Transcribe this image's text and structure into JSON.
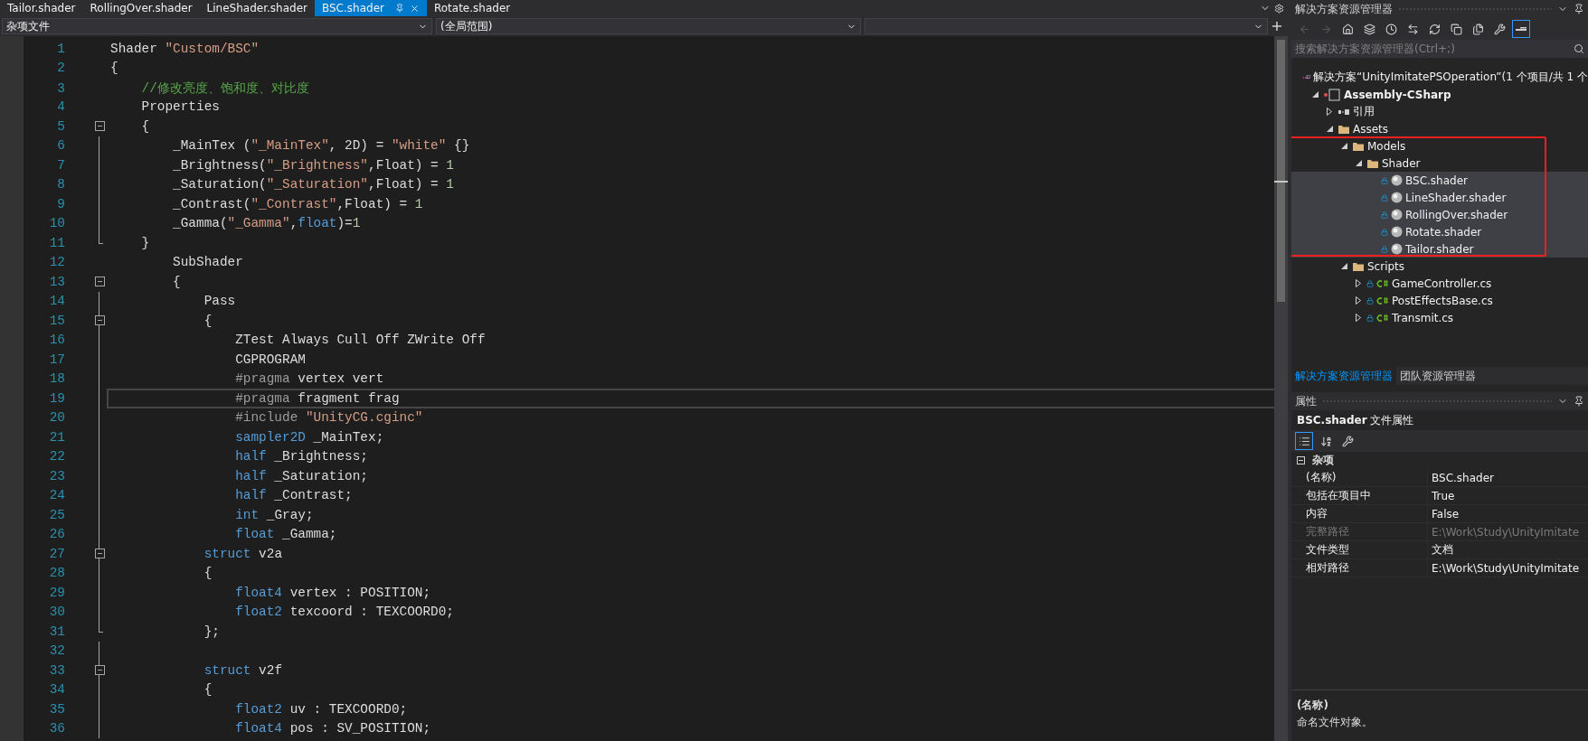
{
  "doc_tabs": [
    {
      "label": "Tailor.shader",
      "selected": false
    },
    {
      "label": "RollingOver.shader",
      "selected": false
    },
    {
      "label": "LineShader.shader",
      "selected": false
    },
    {
      "label": "BSC.shader",
      "selected": true
    },
    {
      "label": "Rotate.shader",
      "selected": false
    }
  ],
  "nav_bar": {
    "project": "杂项文件",
    "scope": "(全局范围)"
  },
  "code_lines": [
    {
      "n": "1",
      "kind": "code",
      "tokens": [
        {
          "kind": "plain",
          "text": "Shader "
        },
        {
          "kind": "string",
          "text": "\"Custom/BSC\""
        }
      ]
    },
    {
      "n": "2",
      "kind": "code",
      "tokens": [
        {
          "kind": "plain",
          "text": "{"
        }
      ]
    },
    {
      "n": "3",
      "kind": "code",
      "tokens": [
        {
          "kind": "comment",
          "text": "    //修改亮度、饱和度、对比度"
        }
      ]
    },
    {
      "n": "4",
      "kind": "code",
      "tokens": [
        {
          "kind": "plain",
          "text": "    Properties"
        }
      ]
    },
    {
      "n": "5",
      "kind": "fold-start",
      "expanded": true,
      "tokens": [
        {
          "kind": "plain",
          "text": "    {"
        }
      ]
    },
    {
      "n": "6",
      "kind": "code",
      "tokens": [
        {
          "kind": "plain",
          "text": "        _MainTex ("
        },
        {
          "kind": "string",
          "text": "\"_MainTex\""
        },
        {
          "kind": "plain",
          "text": ", 2D) = "
        },
        {
          "kind": "string",
          "text": "\"white\""
        },
        {
          "kind": "plain",
          "text": " {}"
        }
      ]
    },
    {
      "n": "7",
      "kind": "code",
      "tokens": [
        {
          "kind": "plain",
          "text": "        _Brightness("
        },
        {
          "kind": "string",
          "text": "\"_Brightness\""
        },
        {
          "kind": "plain",
          "text": ",Float) = "
        },
        {
          "kind": "number",
          "text": "1"
        }
      ]
    },
    {
      "n": "8",
      "kind": "code",
      "tokens": [
        {
          "kind": "plain",
          "text": "        _Saturation("
        },
        {
          "kind": "string",
          "text": "\"_Saturation\""
        },
        {
          "kind": "plain",
          "text": ",Float) = "
        },
        {
          "kind": "number",
          "text": "1"
        }
      ]
    },
    {
      "n": "9",
      "kind": "code",
      "tokens": [
        {
          "kind": "plain",
          "text": "        _Contrast("
        },
        {
          "kind": "string",
          "text": "\"_Contrast\""
        },
        {
          "kind": "plain",
          "text": ",Float) = "
        },
        {
          "kind": "number",
          "text": "1"
        }
      ]
    },
    {
      "n": "10",
      "kind": "code",
      "tokens": [
        {
          "kind": "plain",
          "text": "        _Gamma("
        },
        {
          "kind": "string",
          "text": "\"_Gamma\""
        },
        {
          "kind": "plain",
          "text": ","
        },
        {
          "kind": "keyword",
          "text": "float"
        },
        {
          "kind": "plain",
          "text": ")="
        },
        {
          "kind": "number",
          "text": "1"
        }
      ]
    },
    {
      "n": "11",
      "kind": "fold-end",
      "tokens": [
        {
          "kind": "plain",
          "text": "    }"
        }
      ]
    },
    {
      "n": "12",
      "kind": "code",
      "tokens": [
        {
          "kind": "plain",
          "text": "        SubShader"
        }
      ]
    },
    {
      "n": "13",
      "kind": "fold-start",
      "expanded": true,
      "tokens": [
        {
          "kind": "plain",
          "text": "        {"
        }
      ]
    },
    {
      "n": "14",
      "kind": "code",
      "tokens": [
        {
          "kind": "plain",
          "text": "            Pass"
        }
      ]
    },
    {
      "n": "15",
      "kind": "fold-start",
      "expanded": true,
      "tokens": [
        {
          "kind": "plain",
          "text": "            {"
        }
      ]
    },
    {
      "n": "16",
      "kind": "code",
      "tokens": [
        {
          "kind": "plain",
          "text": "                ZTest Always Cull Off ZWrite Off"
        }
      ]
    },
    {
      "n": "17",
      "kind": "code",
      "tokens": [
        {
          "kind": "plain",
          "text": "                CGPROGRAM"
        }
      ]
    },
    {
      "n": "18",
      "kind": "code",
      "tokens": [
        {
          "kind": "preproc",
          "text": "                #pragma"
        },
        {
          "kind": "plain",
          "text": " vertex vert"
        }
      ]
    },
    {
      "n": "19",
      "kind": "code",
      "current": true,
      "tokens": [
        {
          "kind": "preproc",
          "text": "                #pragma"
        },
        {
          "kind": "plain",
          "text": " fragment frag"
        }
      ]
    },
    {
      "n": "20",
      "kind": "code",
      "tokens": [
        {
          "kind": "preproc",
          "text": "                #include "
        },
        {
          "kind": "string",
          "text": "\"UnityCG.cginc\""
        }
      ]
    },
    {
      "n": "21",
      "kind": "code",
      "tokens": [
        {
          "kind": "keyword",
          "text": "                sampler2D"
        },
        {
          "kind": "plain",
          "text": " _MainTex;"
        }
      ]
    },
    {
      "n": "22",
      "kind": "code",
      "tokens": [
        {
          "kind": "keyword",
          "text": "                half"
        },
        {
          "kind": "plain",
          "text": " _Brightness;"
        }
      ]
    },
    {
      "n": "23",
      "kind": "code",
      "tokens": [
        {
          "kind": "keyword",
          "text": "                half"
        },
        {
          "kind": "plain",
          "text": " _Saturation;"
        }
      ]
    },
    {
      "n": "24",
      "kind": "code",
      "tokens": [
        {
          "kind": "keyword",
          "text": "                half"
        },
        {
          "kind": "plain",
          "text": " _Contrast;"
        }
      ]
    },
    {
      "n": "25",
      "kind": "code",
      "tokens": [
        {
          "kind": "keyword",
          "text": "                int"
        },
        {
          "kind": "plain",
          "text": " _Gray;"
        }
      ]
    },
    {
      "n": "26",
      "kind": "code",
      "tokens": [
        {
          "kind": "keyword",
          "text": "                float"
        },
        {
          "kind": "plain",
          "text": " _Gamma;"
        }
      ]
    },
    {
      "n": "27",
      "kind": "fold-start",
      "expanded": true,
      "tokens": [
        {
          "kind": "keyword",
          "text": "            struct"
        },
        {
          "kind": "plain",
          "text": " v2a"
        }
      ]
    },
    {
      "n": "28",
      "kind": "code",
      "tokens": [
        {
          "kind": "plain",
          "text": "            {"
        }
      ]
    },
    {
      "n": "29",
      "kind": "code",
      "tokens": [
        {
          "kind": "keyword",
          "text": "                float4"
        },
        {
          "kind": "plain",
          "text": " vertex : POSITION;"
        }
      ]
    },
    {
      "n": "30",
      "kind": "code",
      "tokens": [
        {
          "kind": "keyword",
          "text": "                float2"
        },
        {
          "kind": "plain",
          "text": " texcoord : TEXCOORD0;"
        }
      ]
    },
    {
      "n": "31",
      "kind": "fold-end",
      "tokens": [
        {
          "kind": "plain",
          "text": "            };"
        }
      ]
    },
    {
      "n": "32",
      "kind": "code"
    },
    {
      "n": "33",
      "kind": "fold-start",
      "expanded": true,
      "tokens": [
        {
          "kind": "keyword",
          "text": "            struct"
        },
        {
          "kind": "plain",
          "text": " v2f"
        }
      ]
    },
    {
      "n": "34",
      "kind": "code",
      "tokens": [
        {
          "kind": "plain",
          "text": "            {"
        }
      ]
    },
    {
      "n": "35",
      "kind": "code",
      "tokens": [
        {
          "kind": "keyword",
          "text": "                float2"
        },
        {
          "kind": "plain",
          "text": " uv : TEXCOORD0;"
        }
      ]
    },
    {
      "n": "36",
      "kind": "code",
      "tokens": [
        {
          "kind": "keyword",
          "text": "                float4"
        },
        {
          "kind": "plain",
          "text": " pos : SV_POSITION;"
        }
      ]
    }
  ],
  "solution_explorer": {
    "title": "解决方案资源管理器",
    "toolbar": [
      {
        "kind": "back",
        "on": false
      },
      {
        "kind": "forward",
        "on": false
      },
      {
        "kind": "home",
        "on": false
      },
      {
        "kind": "views",
        "on": false
      },
      {
        "kind": "history",
        "on": false
      },
      {
        "kind": "sync",
        "on": false
      },
      {
        "kind": "refresh",
        "on": false
      },
      {
        "kind": "collapse",
        "on": false
      },
      {
        "kind": "show-all",
        "on": false
      },
      {
        "kind": "properties",
        "on": false
      },
      {
        "kind": "preview",
        "on": true
      }
    ],
    "search": {
      "placeholder": "搜索解决方案资源管理器(Ctrl+;)"
    },
    "tree": [
      {
        "label": "解决方案“UnityImitatePSOperation”(1 个项目/共 1 个",
        "kind": "solution",
        "selected": false,
        "children": [
          {
            "label": "Assembly-CSharp",
            "kind": "project",
            "expanded": true,
            "selected": false,
            "children": [
              {
                "label": "引用",
                "kind": "references",
                "expanded": false,
                "selected": false
              },
              {
                "label": "Assets",
                "kind": "folder",
                "expanded": true,
                "selected": false,
                "children": [
                  {
                    "label": "Models",
                    "kind": "folder",
                    "expanded": true,
                    "selected": false,
                    "children": [
                      {
                        "label": "Shader",
                        "kind": "folder",
                        "expanded": true,
                        "selected": false,
                        "children": [
                          {
                            "label": "BSC.shader",
                            "kind": "shader",
                            "selected": true
                          },
                          {
                            "label": "LineShader.shader",
                            "kind": "shader",
                            "selected": true
                          },
                          {
                            "label": "RollingOver.shader",
                            "kind": "shader",
                            "selected": true
                          },
                          {
                            "label": "Rotate.shader",
                            "kind": "shader",
                            "selected": true
                          },
                          {
                            "label": "Tailor.shader",
                            "kind": "shader",
                            "selected": true
                          }
                        ]
                      }
                    ]
                  },
                  {
                    "label": "Scripts",
                    "kind": "folder",
                    "expanded": true,
                    "selected": false,
                    "children": [
                      {
                        "label": "GameController.cs",
                        "kind": "csharp",
                        "expanded": false,
                        "selected": false
                      },
                      {
                        "label": "PostEffectsBase.cs",
                        "kind": "csharp",
                        "expanded": false,
                        "selected": false
                      },
                      {
                        "label": "Transmit.cs",
                        "kind": "csharp",
                        "expanded": false,
                        "selected": false
                      }
                    ]
                  }
                ]
              }
            ]
          }
        ]
      }
    ],
    "annotation": {
      "kind": "outline"
    },
    "bottom_tabs": [
      {
        "label": "解决方案资源管理器",
        "selected": true
      },
      {
        "label": "团队资源管理器",
        "selected": false
      }
    ]
  },
  "properties": {
    "title": "属性",
    "subject": "**BSC.shader** 文件属性",
    "toolbar": [
      {
        "kind": "categorized",
        "on": true
      },
      {
        "kind": "alphabetical",
        "on": false
      },
      {
        "kind": "pages",
        "on": false
      }
    ],
    "category": {
      "label": "杂项",
      "expanded": true
    },
    "rows": [
      {
        "name": "(名称)",
        "value": "BSC.shader",
        "disabled": false
      },
      {
        "name": "包括在项目中",
        "value": "True",
        "disabled": false
      },
      {
        "name": "内容",
        "value": "False",
        "disabled": false
      },
      {
        "name": "完整路径",
        "value": "E:\\Work\\Study\\UnityImitate",
        "disabled": true
      },
      {
        "name": "文件类型",
        "value": "文档",
        "disabled": false
      },
      {
        "name": "相对路径",
        "value": "E:\\Work\\Study\\UnityImitate",
        "disabled": false
      }
    ],
    "description": {
      "title": "(名称)",
      "text": "命名文件对象。"
    }
  }
}
